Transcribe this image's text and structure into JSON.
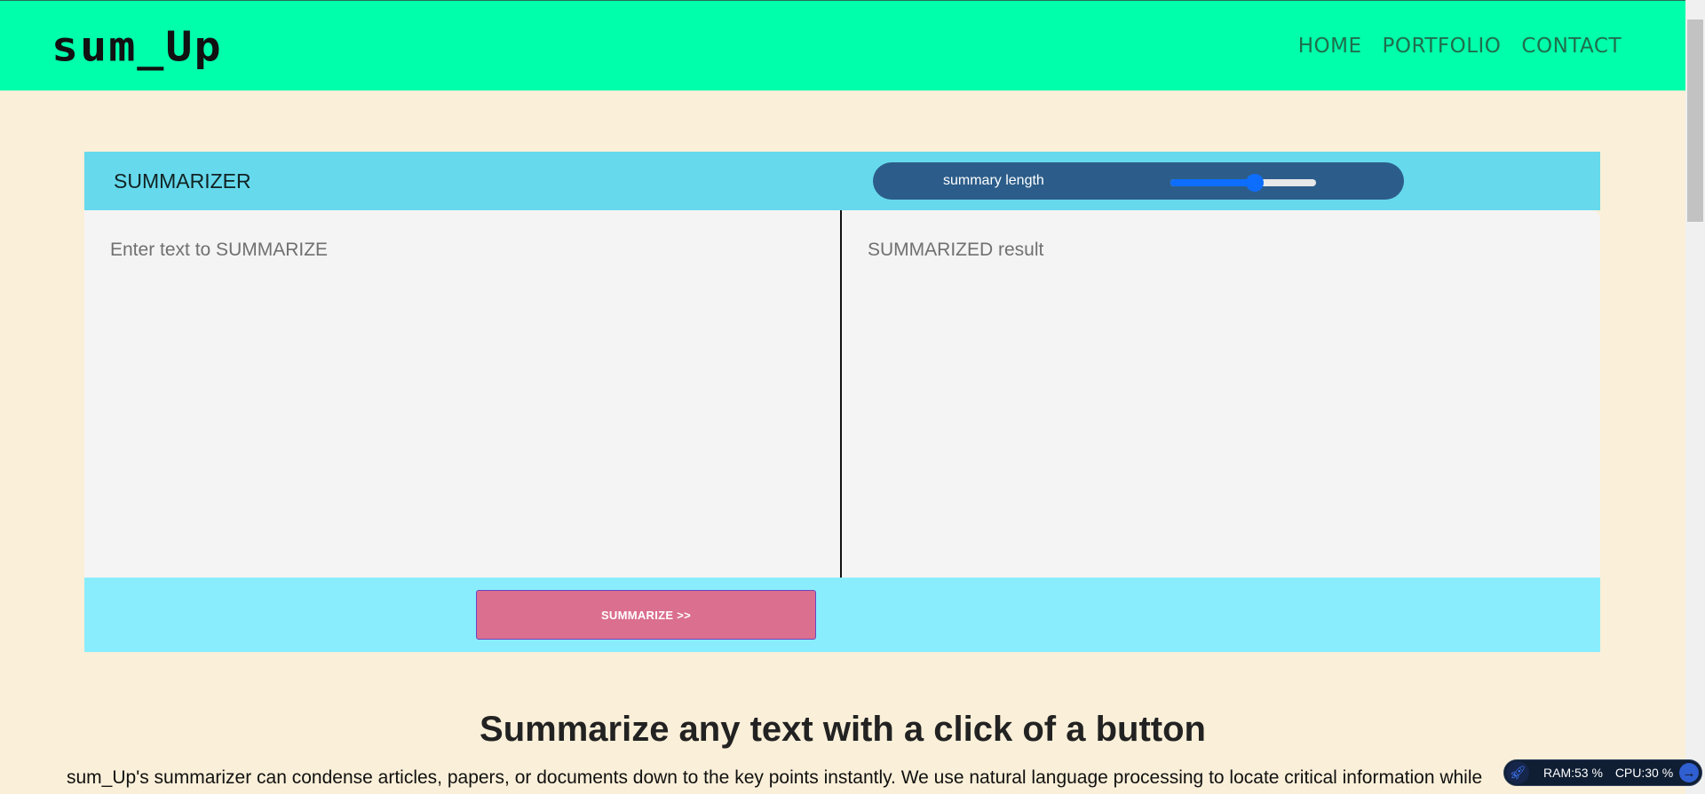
{
  "brand": {
    "logo_text": "sum_Up"
  },
  "nav": {
    "links": [
      "HOME",
      "PORTFOLIO",
      "CONTACT"
    ]
  },
  "summarizer": {
    "title": "SUMMARIZER",
    "length_label": "summary length",
    "length_value": 0.58,
    "input_placeholder": "Enter text to SUMMARIZE",
    "output_placeholder": "SUMMARIZED result",
    "button_label": "SUMMARIZE >>"
  },
  "info": {
    "heading": "Summarize any text with a click of a button",
    "text": "sum_Up's summarizer can condense articles, papers, or documents down to the key points instantly. We use natural language processing to locate critical information while"
  },
  "sysmon": {
    "ram": "RAM:53 %",
    "cpu": "CPU:30 %"
  },
  "colors": {
    "navbar": "#00ffaa",
    "page_bg": "#faefd8",
    "summarizer_header": "#66d9ed",
    "length_pill": "#2c5d8a",
    "slider_accent": "#0d6efd",
    "footer": "#8aedfe",
    "button": "#db6f8f"
  },
  "icons": {
    "sysmon_left": "rocket-icon",
    "sysmon_right": "arrow-right-icon"
  }
}
